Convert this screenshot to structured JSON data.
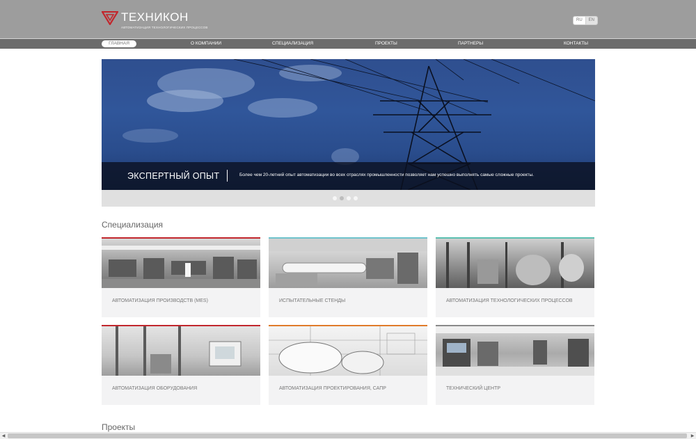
{
  "header": {
    "logo_text": "ТЕХНИКОН",
    "logo_subtitle": "АВТОМАТИЗАЦИЯ ТЕХНОЛОГИЧЕСКИХ ПРОЦЕССОВ",
    "logo_color": "#c2272d",
    "lang_ru": "RU",
    "lang_en": "EN"
  },
  "nav": {
    "items": [
      "ГЛАВНАЯ",
      "О КОМПАНИИ",
      "СПЕЦИАЛИЗАЦИЯ",
      "ПРОЕКТЫ",
      "ПАРТНЕРЫ",
      "КОНТАКТЫ"
    ],
    "active": "ГЛАВНАЯ"
  },
  "slider": {
    "title": "ЭКСПЕРТНЫЙ ОПЫТ",
    "text": "Более чем 20-летний опыт автоматизации во всех отраслях промышленности позволяет нам успешно выполнять самые сложные проекты.",
    "slide_count": 4,
    "active_slide": 2
  },
  "specialization": {
    "title": "Специализация",
    "cards": [
      {
        "label": "АВТОМАТИЗАЦИЯ ПРОИЗВОДСТВ (MES)",
        "accent": "#c2272d",
        "icon": "factory-floor-photo"
      },
      {
        "label": "ИСПЫТАТЕЛЬНЫЕ СТЕНДЫ",
        "accent": "#6fc3cc",
        "icon": "test-bench-photo"
      },
      {
        "label": "АВТОМАТИЗАЦИЯ ТЕХНОЛОГИЧЕСКИХ ПРОЦЕССОВ",
        "accent": "#5bbfb0",
        "icon": "process-plant-photo"
      },
      {
        "label": "АВТОМАТИЗАЦИЯ ОБОРУДОВАНИЯ",
        "accent": "#c2272d",
        "icon": "equipment-photo"
      },
      {
        "label": "АВТОМАТИЗАЦИЯ ПРОЕКТИРОВАНИЯ, САПР",
        "accent": "#e07b2a",
        "icon": "blueprints-photo"
      },
      {
        "label": "ТЕХНИЧЕСКИЙ ЦЕНТР",
        "accent": "#8a8a8a",
        "icon": "tech-center-photo"
      }
    ]
  },
  "projects": {
    "title": "Проекты"
  }
}
